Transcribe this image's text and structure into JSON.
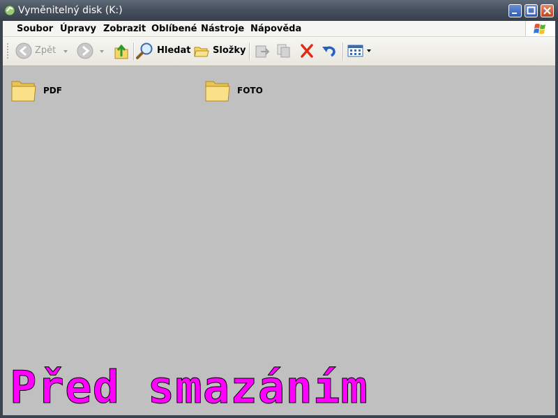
{
  "window": {
    "title": "Vyměnitelný disk (K:)"
  },
  "menu": [
    "Soubor",
    "Úpravy",
    "Zobrazit",
    "Oblíbené",
    "Nástroje",
    "Nápověda"
  ],
  "toolbar": {
    "back_label": "Zpět",
    "search_label": "Hledat",
    "folders_label": "Složky"
  },
  "items": [
    {
      "name": "PDF"
    },
    {
      "name": "FOTO"
    }
  ],
  "overlay_text": "Před smazáním",
  "colors": {
    "overlay": "#ff00ff",
    "content_bg": "#c0c0c0",
    "title_bar": "#4a5462"
  }
}
